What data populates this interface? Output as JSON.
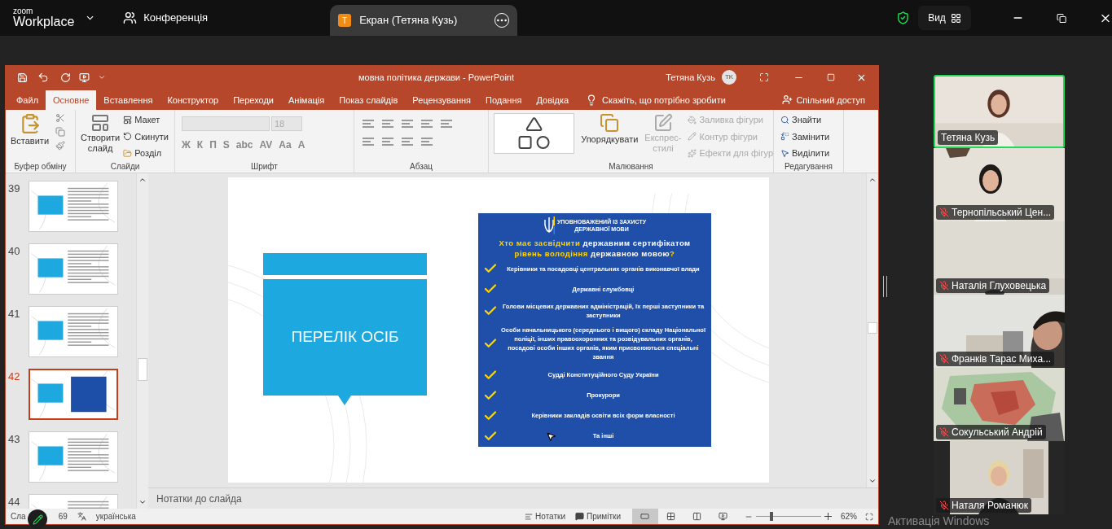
{
  "zoom_bar": {
    "logo_top": "zoom",
    "logo_bottom": "Workplace",
    "meeting_tab": "Конференція",
    "share_tab": {
      "avatar": "T",
      "label": "Екран (Тетяна Кузь)"
    },
    "view_button": "Вид"
  },
  "ppt": {
    "title": "мовна політика держави  -  PowerPoint",
    "user": "Тетяна Кузь",
    "user_initials": "TK",
    "tabs": [
      {
        "label": "Файл",
        "selected": false
      },
      {
        "label": "Основне",
        "selected": true
      },
      {
        "label": "Вставлення",
        "selected": false
      },
      {
        "label": "Конструктор",
        "selected": false
      },
      {
        "label": "Переходи",
        "selected": false
      },
      {
        "label": "Анімація",
        "selected": false
      },
      {
        "label": "Показ слайдів",
        "selected": false
      },
      {
        "label": "Рецензування",
        "selected": false
      },
      {
        "label": "Подання",
        "selected": false
      },
      {
        "label": "Довідка",
        "selected": false
      }
    ],
    "tell_me": "Скажіть, що потрібно зробити",
    "share": "Спільний доступ",
    "ribbon": {
      "clipboard": {
        "label": "Буфер обміну",
        "paste": "Вставити"
      },
      "slides": {
        "label": "Слайди",
        "new_slide": [
          "Створити",
          "слайд"
        ],
        "layout": "Макет",
        "reset": "Скинути",
        "section": "Розділ"
      },
      "font": {
        "label": "Шрифт",
        "size": "18",
        "buttons": [
          "Ж",
          "К",
          "П",
          "S",
          "abc",
          "AV",
          "Aa",
          "A"
        ]
      },
      "paragraph": {
        "label": "Абзац"
      },
      "drawing": {
        "label": "Малювання",
        "arrange": "Упорядкувати",
        "quick_styles": [
          "Експрес-",
          "стилі"
        ],
        "commands": [
          {
            "label": "Заливка фігури",
            "disabled": true
          },
          {
            "label": "Контур фігури",
            "disabled": true
          },
          {
            "label": "Ефекти для фігур",
            "disabled": true
          }
        ]
      },
      "editing": {
        "label": "Редагування",
        "commands": [
          "Знайти",
          "Замінити",
          "Виділити"
        ]
      }
    },
    "thumbnails": [
      {
        "number": "39",
        "kind": "text",
        "selected": false
      },
      {
        "number": "40",
        "kind": "text",
        "selected": false
      },
      {
        "number": "41",
        "kind": "text",
        "selected": false
      },
      {
        "number": "42",
        "kind": "panel",
        "selected": true
      },
      {
        "number": "43",
        "kind": "text",
        "selected": false
      },
      {
        "number": "44",
        "kind": "text",
        "selected": false
      }
    ],
    "slide": {
      "box_title": "ПЕРЕЛІК ОСІБ",
      "panel": {
        "org": [
          "УПОВНОВАЖЕНИЙ ІЗ ЗАХИСТУ",
          "ДЕРЖАВНОЇ МОВИ"
        ],
        "title_lines": [
          [
            {
              "text": "Хто має засвідчити ",
              "highlight": true
            },
            {
              "text": "державним сертифікатом",
              "highlight": false
            }
          ],
          [
            {
              "text": "рівень володіння ",
              "highlight": true
            },
            {
              "text": "державною мовою",
              "highlight": false
            },
            {
              "text": "?",
              "highlight": true
            }
          ]
        ],
        "items": [
          "Керівники та посадовці центральних органів виконавчої влади",
          "Державні службовці",
          "Голови місцевих державних адміністрацій, їх перші заступники та заступники",
          "Особи начальницького (середнього і вищого) складу Національної поліції, інших правоохоронних та розвідувальних органів, посадові особи інших органів, яким присвоюються спеціальні звання",
          "Судді Конституційного Суду України",
          "Прокурори",
          "Керівники закладів освіти всіх форм власності",
          "Та інші"
        ]
      }
    },
    "notes_placeholder": "Нотатки до слайда",
    "status": {
      "slide_prefix": "Сла",
      "slide_count": "69",
      "language": "українська",
      "notes": "Нотатки",
      "comments": "Примітки",
      "views": [
        {
          "kind": "normal",
          "selected": true
        },
        {
          "kind": "sorter",
          "selected": false
        },
        {
          "kind": "reading",
          "selected": false
        },
        {
          "kind": "show",
          "selected": false
        }
      ],
      "zoom_slider": {
        "level": 0.23
      },
      "zoom": "62%"
    }
  },
  "participants": [
    {
      "name": "Тетяна Кузь",
      "muted": false,
      "speaking": true
    },
    {
      "name": "Тернопільський Цен...",
      "muted": true,
      "speaking": false
    },
    {
      "name": "Наталія Глуховецька",
      "muted": true,
      "speaking": false
    },
    {
      "name": "Франків Тарас Миха...",
      "muted": true,
      "speaking": false
    },
    {
      "name": "Сокульський Андрій",
      "muted": true,
      "speaking": false
    },
    {
      "name": "Наталя Романюк",
      "muted": true,
      "speaking": false
    }
  ],
  "os_notice": "Активація Windows"
}
